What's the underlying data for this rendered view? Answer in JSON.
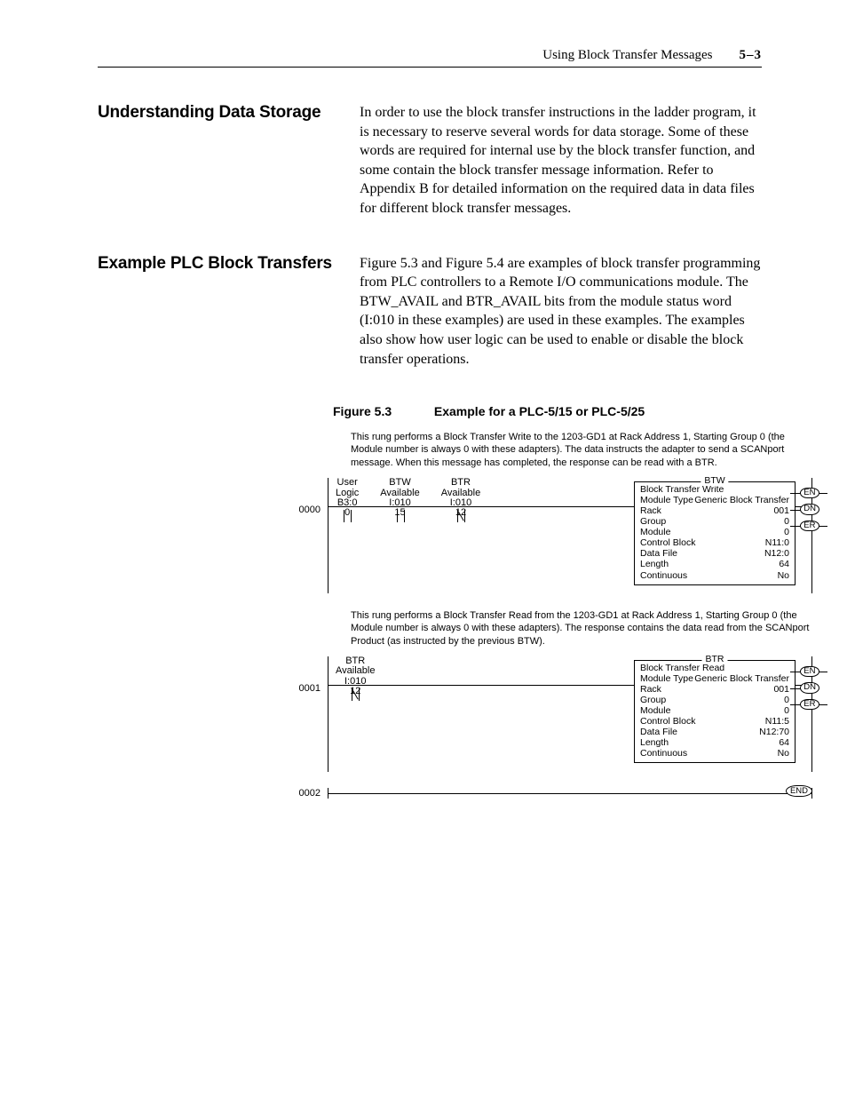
{
  "header": {
    "running_title": "Using Block Transfer Messages",
    "page_number": "5–3"
  },
  "sections": [
    {
      "heading": "Understanding Data Storage",
      "body": "In order to use the block transfer instructions in the ladder program, it is necessary to reserve several words for data storage. Some of these words are required for internal use by the block transfer function, and some contain the block transfer message information. Refer to Appendix B for detailed information on the required data in data files for different block transfer messages."
    },
    {
      "heading": "Example PLC Block Transfers",
      "body": "Figure 5.3 and Figure 5.4 are examples of block transfer programming from PLC controllers to a Remote I/O communications module. The BTW_AVAIL and BTR_AVAIL bits from the module status word (I:010 in these examples) are used in these examples. The examples also show how user logic can be used to enable or disable the block transfer operations."
    }
  ],
  "figure": {
    "number": "Figure 5.3",
    "title": "Example for a PLC-5/15 or PLC-5/25",
    "rungs": [
      {
        "num": "0000",
        "desc": "This rung performs a Block Transfer Write to the 1203-GD1 at Rack Address 1, Starting Group 0 (the Module number is always 0 with these adapters). The data instructs the adapter to send a SCANport message. When this message has completed, the response can be read with a BTR.",
        "contacts": [
          {
            "l1": "User",
            "l2": "Logic",
            "l3": "B3:0",
            "type": "xic",
            "bit": "0"
          },
          {
            "l1": "BTW",
            "l2": "Available",
            "l3": "I:010",
            "type": "xic",
            "bit": "15"
          },
          {
            "l1": "BTR",
            "l2": "Available",
            "l3": "I:010",
            "type": "xio",
            "bit": "12"
          }
        ],
        "block": {
          "tag": "BTW",
          "title": "Block Transfer Write",
          "module_type": "Generic Block Transfer",
          "rows": [
            [
              "Rack",
              "001"
            ],
            [
              "Group",
              "0"
            ],
            [
              "Module",
              "0"
            ],
            [
              "Control Block",
              "N11:0"
            ],
            [
              "Data File",
              "N12:0"
            ],
            [
              "Length",
              "64"
            ],
            [
              "Continuous",
              "No"
            ]
          ],
          "flags": [
            "EN",
            "DN",
            "ER"
          ]
        }
      },
      {
        "num": "0001",
        "desc": "This rung performs a Block Transfer Read from the 1203-GD1 at Rack Address 1, Starting Group 0 (the Module number is always 0 with these adapters). The response contains the data read from the SCANport Product (as instructed by the previous BTW).",
        "contacts": [
          {
            "l1": "BTR",
            "l2": "Available",
            "l3": "I:010",
            "type": "xio",
            "bit": "12"
          }
        ],
        "block": {
          "tag": "BTR",
          "title": "Block Transfer Read",
          "module_type": "Generic Block Transfer",
          "rows": [
            [
              "Rack",
              "001"
            ],
            [
              "Group",
              "0"
            ],
            [
              "Module",
              "0"
            ],
            [
              "Control Block",
              "N11:5"
            ],
            [
              "Data File",
              "N12:70"
            ],
            [
              "Length",
              "64"
            ],
            [
              "Continuous",
              "No"
            ]
          ],
          "flags": [
            "EN",
            "DN",
            "ER"
          ]
        }
      },
      {
        "num": "0002",
        "end": "END"
      }
    ]
  }
}
